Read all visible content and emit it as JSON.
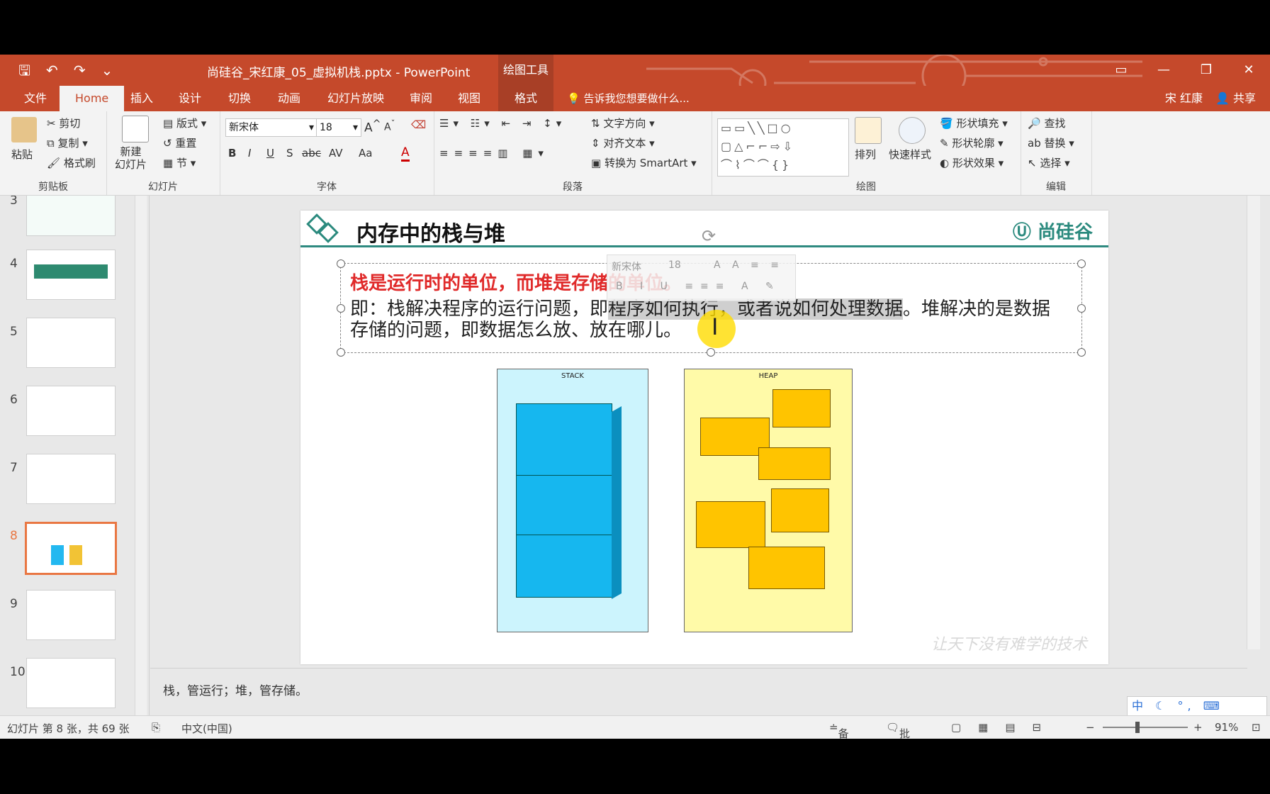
{
  "titlebar": {
    "doc_title": "尚硅谷_宋红康_05_虚拟机栈.pptx - PowerPoint",
    "context_tab_group": "绘图工具",
    "accent": "#c5492b"
  },
  "tabs": [
    "文件",
    "Home",
    "插入",
    "设计",
    "切换",
    "动画",
    "幻灯片放映",
    "审阅",
    "视图",
    "格式"
  ],
  "tell_me": "告诉我您想要做什么...",
  "user": {
    "name": "宋 红康",
    "share": "共享"
  },
  "ribbon": {
    "clipboard": {
      "label": "剪贴板",
      "paste": "粘贴",
      "cut": "剪切",
      "copy": "复制",
      "format_painter": "格式刷"
    },
    "slides": {
      "label": "幻灯片",
      "new_slide": "新建\n幻灯片",
      "layout": "版式",
      "reset": "重置",
      "section": "节"
    },
    "font": {
      "label": "字体",
      "font_name": "新宋体",
      "font_size": "18",
      "bold": "B",
      "italic": "I",
      "underline": "U",
      "shadow": "S",
      "strike": "abc",
      "spacing": "AV",
      "case": "Aa"
    },
    "paragraph": {
      "label": "段落",
      "text_direction": "文字方向",
      "align_text": "对齐文本",
      "smartart": "转换为 SmartArt"
    },
    "drawing": {
      "label": "绘图",
      "arrange": "排列",
      "quick_styles": "快速样式",
      "shape_fill": "形状填充",
      "shape_outline": "形状轮廓",
      "shape_effects": "形状效果"
    },
    "editing": {
      "label": "编辑",
      "find": "查找",
      "replace": "替换",
      "select": "选择"
    }
  },
  "thumbnails": [
    {
      "num": "3"
    },
    {
      "num": "4"
    },
    {
      "num": "5"
    },
    {
      "num": "6"
    },
    {
      "num": "7"
    },
    {
      "num": "8",
      "selected": true
    },
    {
      "num": "9"
    },
    {
      "num": "10"
    }
  ],
  "slide": {
    "title": "内存中的栈与堆",
    "logo": "尚硅谷",
    "red_line": "栈是运行时的单位，而堆是存储的单位。",
    "body_pre": "即：栈解决程序的运行问题，即",
    "body_highlight": "程序如何执行，或者说如何处理数据",
    "body_post": "。堆解决的是数据存储的问题，即数据怎么放、放在哪儿。",
    "stack_label": "STACK",
    "heap_label": "HEAP",
    "watermark": "让天下没有难学的技术",
    "mini_font": "新宋体",
    "mini_size": "18"
  },
  "notes": "栈，管运行；堆，管存储。",
  "status": {
    "slide_info": "幻灯片 第 8 张，共 69 张",
    "language": "中文(中国)",
    "notes": "备注",
    "comments": "批注",
    "zoom": "91%"
  },
  "ime": "中 ☾ °, ⌨"
}
